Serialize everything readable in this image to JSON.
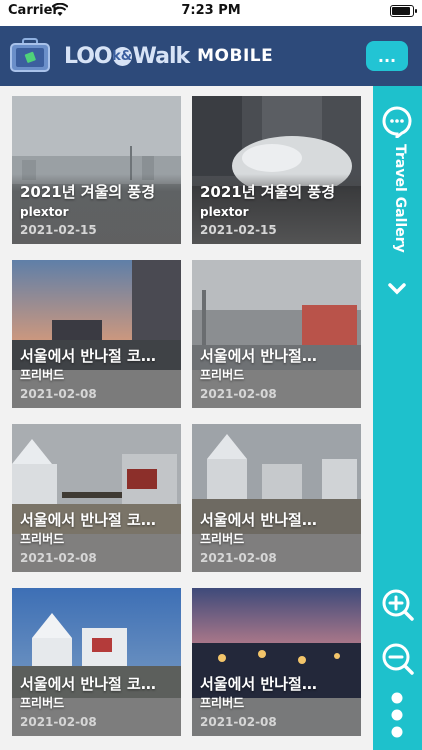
{
  "status_bar": {
    "carrier": "Carrier",
    "time": "7:23 PM"
  },
  "header": {
    "logo_look": "LOO",
    "logo_amp": "k&",
    "logo_walk": "Walk",
    "logo_mobile": "MOBILE",
    "menu_label": "..."
  },
  "side_panel": {
    "title": "Travel Gallery",
    "icons": [
      "chat-bubble-icon",
      "chevron-down-icon",
      "zoom-in-icon",
      "zoom-out-icon",
      "more-vertical-icon"
    ],
    "color": "#1ec1cc"
  },
  "gallery": {
    "items": [
      {
        "title": "2021년 겨울의 풍경",
        "author": "plextor",
        "date": "2021-02-15"
      },
      {
        "title": "2021년 겨울의 풍경",
        "author": "plextor",
        "date": "2021-02-15"
      },
      {
        "title": "서울에서 반나절 코…",
        "author": "프리버드",
        "date": "2021-02-08"
      },
      {
        "title": "서울에서 반나절…",
        "author": "프리버드",
        "date": "2021-02-08"
      },
      {
        "title": "서울에서 반나절 코…",
        "author": "프리버드",
        "date": "2021-02-08"
      },
      {
        "title": "서울에서 반나절…",
        "author": "프리버드",
        "date": "2021-02-08"
      },
      {
        "title": "서울에서 반나절 코…",
        "author": "프리버드",
        "date": "2021-02-08"
      },
      {
        "title": "서울에서 반나절…",
        "author": "프리버드",
        "date": "2021-02-08"
      }
    ]
  },
  "colors": {
    "header": "#2d4a7a",
    "accent": "#22c4d4",
    "side_panel": "#1ec1cc"
  }
}
